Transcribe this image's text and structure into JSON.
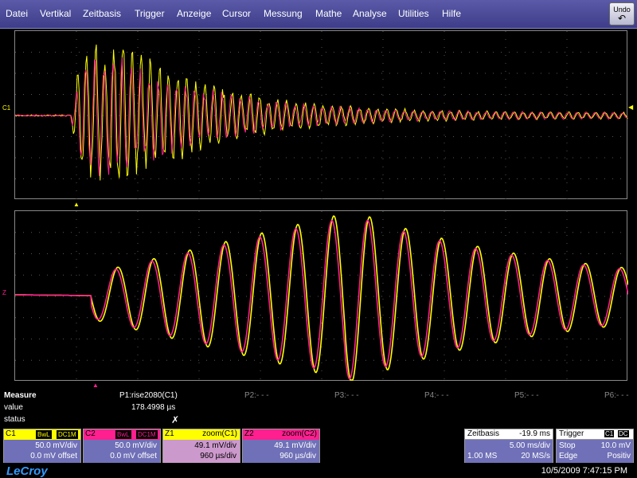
{
  "menu": [
    "Datei",
    "Vertikal",
    "Zeitbasis",
    "Trigger",
    "Anzeige",
    "Cursor",
    "Messung",
    "Mathe",
    "Analyse",
    "Utilities",
    "Hilfe"
  ],
  "undo_label": "Undo",
  "markers": {
    "c1": "C1",
    "z": "Z"
  },
  "measure": {
    "title": "Measure",
    "rows": {
      "value": "value",
      "status": "status"
    },
    "p1": "P1:rise2080(C1)",
    "p1_value": "178.4998 µs",
    "p2": "P2:- - -",
    "p3": "P3:- - -",
    "p4": "P4:- - -",
    "p5": "P5:- - -",
    "p6": "P6:- - -"
  },
  "channels": {
    "c1": {
      "name": "C1",
      "tag1": "BwL",
      "tag2": "DC1M",
      "vdiv": "50.0 mV/div",
      "offset": "0.0 mV offset",
      "color": "#ffff00"
    },
    "c2": {
      "name": "C2",
      "tag1": "BwL",
      "tag2": "DC1M",
      "vdiv": "50.0 mV/div",
      "offset": "0.0 mV offset",
      "color": "#ff1f8f"
    },
    "z1": {
      "name": "Z1",
      "source": "zoom(C1)",
      "vdiv": "49.1 mV/div",
      "tdiv": "960 µs/div"
    },
    "z2": {
      "name": "Z2",
      "source": "zoom(C2)",
      "vdiv": "49.1 mV/div",
      "tdiv": "960 µs/div"
    }
  },
  "timebase": {
    "label": "Zeitbasis",
    "delay": "-19.9 ms",
    "tdiv": "5.00 ms/div",
    "samples": "1.00 MS",
    "rate": "20 MS/s"
  },
  "trigger": {
    "label": "Trigger",
    "src1": "C1",
    "src2": "DC",
    "mode": "Stop",
    "level": "10.0 mV",
    "type": "Edge",
    "slope": "Positiv"
  },
  "footer": {
    "logo": "LeCroy",
    "datetime": "10/5/2009 7:47:15 PM"
  },
  "colors": {
    "c1": "#ffff00",
    "c2": "#ff1f8f",
    "menu_bg": "#4a4a98"
  }
}
